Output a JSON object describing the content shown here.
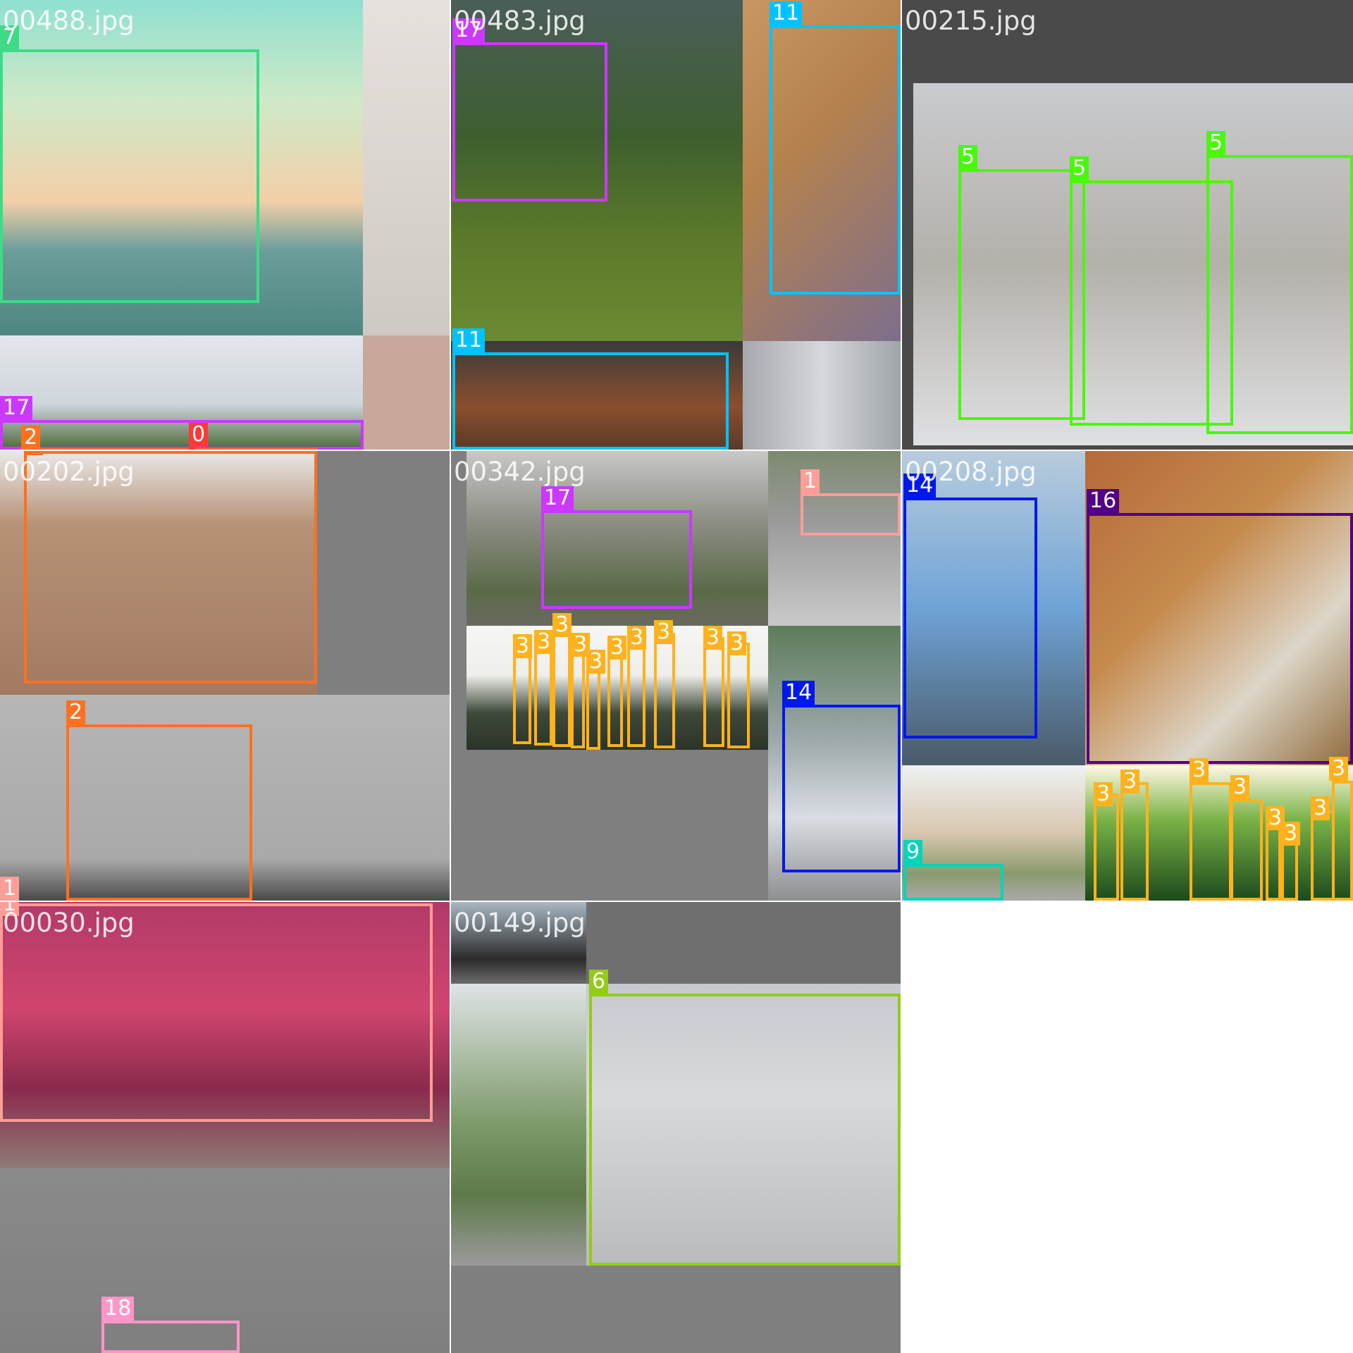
{
  "tiles": [
    {
      "filename": "00488.jpg"
    },
    {
      "filename": "00483.jpg"
    },
    {
      "filename": "00215.jpg"
    },
    {
      "filename": "00202.jpg"
    },
    {
      "filename": "00342.jpg"
    },
    {
      "filename": "00208.jpg"
    },
    {
      "filename": "00030.jpg"
    },
    {
      "filename": "00149.jpg"
    }
  ],
  "class_colors": {
    "0": "#ff3838",
    "1": "#ff9d97",
    "2": "#ff701f",
    "3": "#ffb21d",
    "5": "#48f90a",
    "6": "#92cc17",
    "7": "#3ddb86",
    "9": "#00d4bb",
    "11": "#00c2ff",
    "14": "#0018ec",
    "16": "#520085",
    "17": "#cb38ff",
    "18": "#ff95c8"
  },
  "detections": [
    {
      "tile": 0,
      "label": "7"
    },
    {
      "tile": 0,
      "label": "17"
    },
    {
      "tile": 0,
      "label": "2"
    },
    {
      "tile": 0,
      "label": "0"
    },
    {
      "tile": 1,
      "label": "17"
    },
    {
      "tile": 1,
      "label": "11"
    },
    {
      "tile": 1,
      "label": "11"
    },
    {
      "tile": 2,
      "label": "5"
    },
    {
      "tile": 2,
      "label": "5"
    },
    {
      "tile": 2,
      "label": "5"
    },
    {
      "tile": 3,
      "label": "2"
    },
    {
      "tile": 3,
      "label": "2"
    },
    {
      "tile": 3,
      "label": "1"
    },
    {
      "tile": 4,
      "label": "17"
    },
    {
      "tile": 4,
      "label": "1"
    },
    {
      "tile": 4,
      "label": "3"
    },
    {
      "tile": 4,
      "label": "3"
    },
    {
      "tile": 4,
      "label": "3"
    },
    {
      "tile": 4,
      "label": "3"
    },
    {
      "tile": 4,
      "label": "3"
    },
    {
      "tile": 4,
      "label": "3"
    },
    {
      "tile": 4,
      "label": "3"
    },
    {
      "tile": 4,
      "label": "3"
    },
    {
      "tile": 4,
      "label": "3"
    },
    {
      "tile": 4,
      "label": "3"
    },
    {
      "tile": 4,
      "label": "14"
    },
    {
      "tile": 5,
      "label": "14"
    },
    {
      "tile": 5,
      "label": "16"
    },
    {
      "tile": 5,
      "label": "9"
    },
    {
      "tile": 5,
      "label": "3"
    },
    {
      "tile": 5,
      "label": "3"
    },
    {
      "tile": 5,
      "label": "3"
    },
    {
      "tile": 5,
      "label": "3"
    },
    {
      "tile": 5,
      "label": "3"
    },
    {
      "tile": 5,
      "label": "3"
    },
    {
      "tile": 5,
      "label": "3"
    },
    {
      "tile": 5,
      "label": "3"
    },
    {
      "tile": 6,
      "label": "1"
    },
    {
      "tile": 6,
      "label": "18"
    },
    {
      "tile": 7,
      "label": "6"
    }
  ]
}
